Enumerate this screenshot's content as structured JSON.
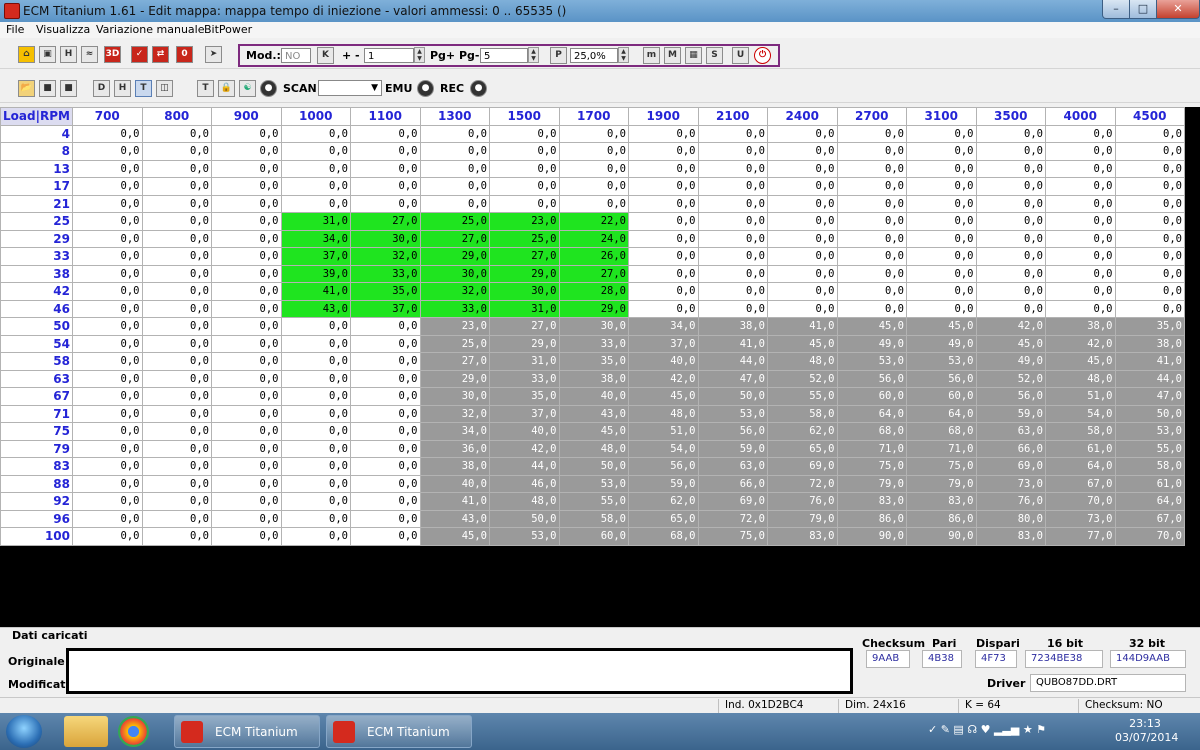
{
  "window": {
    "title": "ECM Titanium 1.61 - Edit mappa: mappa tempo di iniezione - valori ammessi: 0 .. 65535 ()"
  },
  "menu": [
    "File",
    "Visualizza",
    "Variazione manuale",
    "BitPower"
  ],
  "toolbar": {
    "mod_label": "Mod.:",
    "mod_value": "NO",
    "plusminus_label": "+ -",
    "plusminus_value": "1",
    "pg_label": "Pg+ Pg-",
    "pg_value": "5",
    "percent_value": "25,0%",
    "scan_label": "SCAN",
    "emu_label": "EMU",
    "rec_label": "REC"
  },
  "grid": {
    "corner": "Load|RPM",
    "rpm": [
      "700",
      "800",
      "900",
      "1000",
      "1100",
      "1300",
      "1500",
      "1700",
      "1900",
      "2100",
      "2400",
      "2700",
      "3100",
      "3500",
      "4000",
      "4500"
    ],
    "loads": [
      "4",
      "8",
      "13",
      "17",
      "21",
      "25",
      "29",
      "33",
      "38",
      "42",
      "46",
      "50",
      "54",
      "58",
      "63",
      "67",
      "71",
      "75",
      "79",
      "83",
      "88",
      "92",
      "96",
      "100"
    ],
    "values": [
      [
        "0,0",
        "0,0",
        "0,0",
        "0,0",
        "0,0",
        "0,0",
        "0,0",
        "0,0",
        "0,0",
        "0,0",
        "0,0",
        "0,0",
        "0,0",
        "0,0",
        "0,0",
        "0,0"
      ],
      [
        "0,0",
        "0,0",
        "0,0",
        "0,0",
        "0,0",
        "0,0",
        "0,0",
        "0,0",
        "0,0",
        "0,0",
        "0,0",
        "0,0",
        "0,0",
        "0,0",
        "0,0",
        "0,0"
      ],
      [
        "0,0",
        "0,0",
        "0,0",
        "0,0",
        "0,0",
        "0,0",
        "0,0",
        "0,0",
        "0,0",
        "0,0",
        "0,0",
        "0,0",
        "0,0",
        "0,0",
        "0,0",
        "0,0"
      ],
      [
        "0,0",
        "0,0",
        "0,0",
        "0,0",
        "0,0",
        "0,0",
        "0,0",
        "0,0",
        "0,0",
        "0,0",
        "0,0",
        "0,0",
        "0,0",
        "0,0",
        "0,0",
        "0,0"
      ],
      [
        "0,0",
        "0,0",
        "0,0",
        "0,0",
        "0,0",
        "0,0",
        "0,0",
        "0,0",
        "0,0",
        "0,0",
        "0,0",
        "0,0",
        "0,0",
        "0,0",
        "0,0",
        "0,0"
      ],
      [
        "0,0",
        "0,0",
        "0,0",
        "31,0",
        "27,0",
        "25,0",
        "23,0",
        "22,0",
        "0,0",
        "0,0",
        "0,0",
        "0,0",
        "0,0",
        "0,0",
        "0,0",
        "0,0"
      ],
      [
        "0,0",
        "0,0",
        "0,0",
        "34,0",
        "30,0",
        "27,0",
        "25,0",
        "24,0",
        "0,0",
        "0,0",
        "0,0",
        "0,0",
        "0,0",
        "0,0",
        "0,0",
        "0,0"
      ],
      [
        "0,0",
        "0,0",
        "0,0",
        "37,0",
        "32,0",
        "29,0",
        "27,0",
        "26,0",
        "0,0",
        "0,0",
        "0,0",
        "0,0",
        "0,0",
        "0,0",
        "0,0",
        "0,0"
      ],
      [
        "0,0",
        "0,0",
        "0,0",
        "39,0",
        "33,0",
        "30,0",
        "29,0",
        "27,0",
        "0,0",
        "0,0",
        "0,0",
        "0,0",
        "0,0",
        "0,0",
        "0,0",
        "0,0"
      ],
      [
        "0,0",
        "0,0",
        "0,0",
        "41,0",
        "35,0",
        "32,0",
        "30,0",
        "28,0",
        "0,0",
        "0,0",
        "0,0",
        "0,0",
        "0,0",
        "0,0",
        "0,0",
        "0,0"
      ],
      [
        "0,0",
        "0,0",
        "0,0",
        "43,0",
        "37,0",
        "33,0",
        "31,0",
        "29,0",
        "0,0",
        "0,0",
        "0,0",
        "0,0",
        "0,0",
        "0,0",
        "0,0",
        "0,0"
      ],
      [
        "0,0",
        "0,0",
        "0,0",
        "0,0",
        "0,0",
        "23,0",
        "27,0",
        "30,0",
        "34,0",
        "38,0",
        "41,0",
        "45,0",
        "45,0",
        "42,0",
        "38,0",
        "35,0"
      ],
      [
        "0,0",
        "0,0",
        "0,0",
        "0,0",
        "0,0",
        "25,0",
        "29,0",
        "33,0",
        "37,0",
        "41,0",
        "45,0",
        "49,0",
        "49,0",
        "45,0",
        "42,0",
        "38,0"
      ],
      [
        "0,0",
        "0,0",
        "0,0",
        "0,0",
        "0,0",
        "27,0",
        "31,0",
        "35,0",
        "40,0",
        "44,0",
        "48,0",
        "53,0",
        "53,0",
        "49,0",
        "45,0",
        "41,0"
      ],
      [
        "0,0",
        "0,0",
        "0,0",
        "0,0",
        "0,0",
        "29,0",
        "33,0",
        "38,0",
        "42,0",
        "47,0",
        "52,0",
        "56,0",
        "56,0",
        "52,0",
        "48,0",
        "44,0"
      ],
      [
        "0,0",
        "0,0",
        "0,0",
        "0,0",
        "0,0",
        "30,0",
        "35,0",
        "40,0",
        "45,0",
        "50,0",
        "55,0",
        "60,0",
        "60,0",
        "56,0",
        "51,0",
        "47,0"
      ],
      [
        "0,0",
        "0,0",
        "0,0",
        "0,0",
        "0,0",
        "32,0",
        "37,0",
        "43,0",
        "48,0",
        "53,0",
        "58,0",
        "64,0",
        "64,0",
        "59,0",
        "54,0",
        "50,0"
      ],
      [
        "0,0",
        "0,0",
        "0,0",
        "0,0",
        "0,0",
        "34,0",
        "40,0",
        "45,0",
        "51,0",
        "56,0",
        "62,0",
        "68,0",
        "68,0",
        "63,0",
        "58,0",
        "53,0"
      ],
      [
        "0,0",
        "0,0",
        "0,0",
        "0,0",
        "0,0",
        "36,0",
        "42,0",
        "48,0",
        "54,0",
        "59,0",
        "65,0",
        "71,0",
        "71,0",
        "66,0",
        "61,0",
        "55,0"
      ],
      [
        "0,0",
        "0,0",
        "0,0",
        "0,0",
        "0,0",
        "38,0",
        "44,0",
        "50,0",
        "56,0",
        "63,0",
        "69,0",
        "75,0",
        "75,0",
        "69,0",
        "64,0",
        "58,0"
      ],
      [
        "0,0",
        "0,0",
        "0,0",
        "0,0",
        "0,0",
        "40,0",
        "46,0",
        "53,0",
        "59,0",
        "66,0",
        "72,0",
        "79,0",
        "79,0",
        "73,0",
        "67,0",
        "61,0"
      ],
      [
        "0,0",
        "0,0",
        "0,0",
        "0,0",
        "0,0",
        "41,0",
        "48,0",
        "55,0",
        "62,0",
        "69,0",
        "76,0",
        "83,0",
        "83,0",
        "76,0",
        "70,0",
        "64,0"
      ],
      [
        "0,0",
        "0,0",
        "0,0",
        "0,0",
        "0,0",
        "43,0",
        "50,0",
        "58,0",
        "65,0",
        "72,0",
        "79,0",
        "86,0",
        "86,0",
        "80,0",
        "73,0",
        "67,0"
      ],
      [
        "0,0",
        "0,0",
        "0,0",
        "0,0",
        "0,0",
        "45,0",
        "53,0",
        "60,0",
        "68,0",
        "75,0",
        "83,0",
        "90,0",
        "90,0",
        "83,0",
        "77,0",
        "70,0"
      ]
    ],
    "green_block": {
      "rows": [
        5,
        10
      ],
      "cols": [
        3,
        7
      ],
      "color": "#1fe41f"
    },
    "gray_block": {
      "rows": [
        11,
        23
      ],
      "cols": [
        5,
        15
      ],
      "color": "#9a9a9a"
    }
  },
  "info": {
    "dati_caricati": "Dati caricati",
    "originale": "Originale",
    "modificato": "Modificato",
    "checksum_label": "Checksum",
    "pari_label": "Pari",
    "dispari_label": "Dispari",
    "bit16_label": "16 bit",
    "bit32_label": "32 bit",
    "checksum": "9AAB",
    "pari": "4B38",
    "dispari": "4F73",
    "bit16": "7234BE38",
    "bit32": "144D9AAB",
    "driver_label": "Driver",
    "driver": "QUBO87DD.DRT"
  },
  "status": {
    "ind": "Ind. 0x1D2BC4",
    "dim": "Dim. 24x16",
    "k": "K = 64",
    "checksum": "Checksum: NO"
  },
  "taskbar": {
    "items": [
      "ECM Titanium",
      "ECM Titanium"
    ],
    "time": "23:13",
    "date": "03/07/2014"
  }
}
